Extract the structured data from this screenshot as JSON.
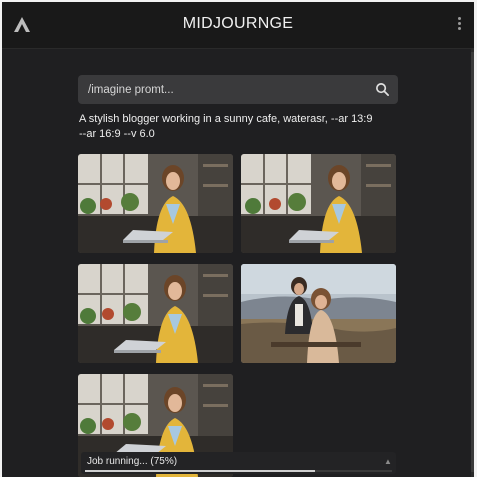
{
  "app": {
    "title": "MIDJOURNGE",
    "logo_icon": "triangle-logo-icon",
    "menu_icon": "kebab-menu-icon"
  },
  "search": {
    "placeholder": "/imagine promt...",
    "icon": "search-icon"
  },
  "prompt": {
    "line1": "A stylish blogger working in a sunny cafe, waterasr, --ar 13:9",
    "line2": "--ar 16:9 --v 6.0"
  },
  "images": [
    {
      "name": "image-1"
    },
    {
      "name": "image-2"
    },
    {
      "name": "image-3"
    },
    {
      "name": "image-4"
    },
    {
      "name": "image-5"
    }
  ],
  "job": {
    "status_text": "Job running... (75%)",
    "progress": 0.75
  },
  "colors": {
    "background": "#1f1f21",
    "topbar": "#191919",
    "search_bg": "#3a3a3c",
    "accent_yellow": "#e3b53a"
  }
}
